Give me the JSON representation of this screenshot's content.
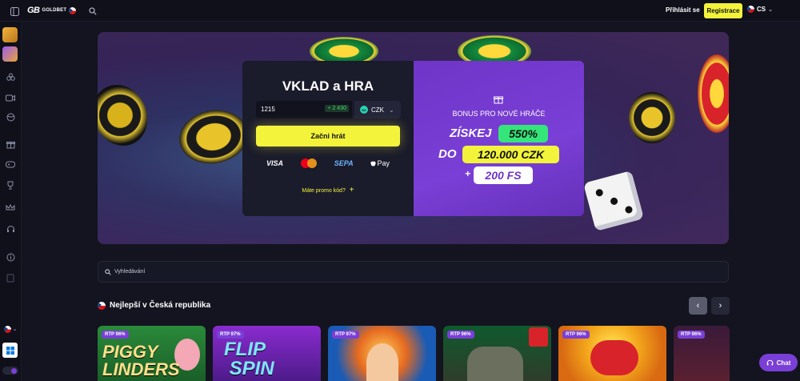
{
  "header": {
    "logo_mark": "GB",
    "logo_text": "GOLDBET",
    "login_label": "Přihlásit se",
    "register_label": "Registrace",
    "language": "CS"
  },
  "hero": {
    "title": "VKLAD a HRA",
    "amount_value": "1215",
    "amount_bonus": "+ 2 430",
    "currency": "CZK",
    "currency_badge": "Kč",
    "play_label": "Začni hrát",
    "payments": [
      "VISA",
      "SEPA",
      "Pay"
    ],
    "promo_label": "Máte promo kód?",
    "bonus_label": "BONUS PRO NOVÉ HRÁČE",
    "bonus_get": "ZÍSKEJ",
    "bonus_percent": "550%",
    "bonus_up_to": "DO",
    "bonus_amount": "120.000 CZK",
    "bonus_plus": "+",
    "bonus_fs": "200 FS"
  },
  "search": {
    "placeholder": "Vyhledávání"
  },
  "section": {
    "title": "Nejlepší v Česká republika"
  },
  "games": [
    {
      "rtp": "RTP 96%",
      "title": "PIGGY\nLINDERS"
    },
    {
      "rtp": "RTP 97%",
      "title": "FLIP\nSPIN"
    },
    {
      "rtp": "RTP 97%",
      "title": ""
    },
    {
      "rtp": "RTP 96%",
      "title": ""
    },
    {
      "rtp": "RTP 96%",
      "title": ""
    },
    {
      "rtp": "RTP 96%",
      "title": ""
    }
  ],
  "chat": {
    "label": "Chat"
  },
  "colors": {
    "accent_yellow": "#f3f33b",
    "accent_purple": "#7a3fd6",
    "bg": "#13141f"
  }
}
